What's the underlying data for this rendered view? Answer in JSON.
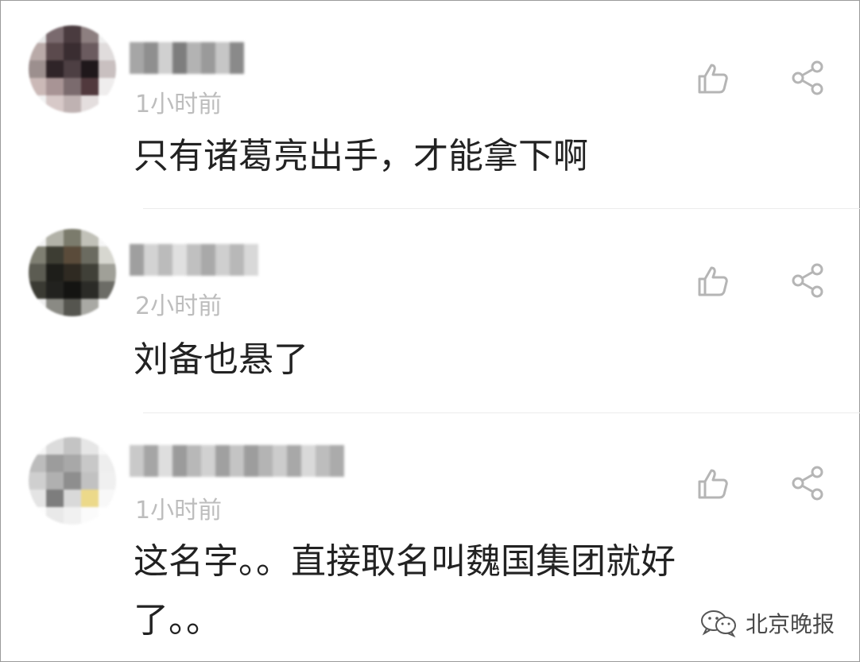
{
  "comments": [
    {
      "timestamp": "1小时前",
      "text": "只有诸葛亮出手，才能拿下啊",
      "avatar_colors": [
        "#e8e8e8",
        "#7a6a6e",
        "#4a3b3f",
        "#8d7f80",
        "#f0f0f0",
        "#b9aaa8",
        "#5b4a4d",
        "#3a2d31",
        "#6b5b5f",
        "#e0dcdc",
        "#9c8f8e",
        "#2f2428",
        "#4d3f43",
        "#1f181b",
        "#c9c0c0",
        "#cbb9b7",
        "#a89495",
        "#7b6b6e",
        "#51393d",
        "#efeded",
        "#f2f2f2",
        "#d7c9c8",
        "#bfb2b2",
        "#e4dede",
        "#ffffff"
      ],
      "username_colors": [
        "#a6a6a6",
        "#8f8f8f",
        "#d0d0d0",
        "#7d7d7d",
        "#b3b3b3",
        "#9a9a9a",
        "#c6c6c6",
        "#8a8a8a"
      ]
    },
    {
      "timestamp": "2小时前",
      "text": "刘备也悬了",
      "avatar_colors": [
        "#f3f3f3",
        "#b2b2a8",
        "#7b7b6c",
        "#c1c1b8",
        "#f6f6f6",
        "#7f7f72",
        "#3d3d33",
        "#5a4b3a",
        "#6b6b60",
        "#d7d7d0",
        "#5c5c52",
        "#1e1e1a",
        "#2f2a22",
        "#404038",
        "#a0a098",
        "#3a3a33",
        "#22221f",
        "#141412",
        "#2b2b27",
        "#6c6c66",
        "#eeeeee",
        "#8a8a84",
        "#55554f",
        "#a9a9a4",
        "#ffffff"
      ],
      "username_colors": [
        "#9f9f9f",
        "#d3d3d3",
        "#bbbbbb",
        "#e0e0e0",
        "#c0c0c0",
        "#a9a9a9",
        "#cfcfcf",
        "#b8b8b8",
        "#d8d8d8"
      ]
    },
    {
      "timestamp": "1小时前",
      "text_line1": "这名字。。直接取名叫魏国集团就好",
      "text_line2": "了。。",
      "avatar_colors": [
        "#f6f6f6",
        "#dcdcdc",
        "#c4c4c4",
        "#e6e6e6",
        "#fafafa",
        "#bcbcbc",
        "#9c9c9c",
        "#a8a8a8",
        "#c8c8c8",
        "#eeeeee",
        "#cfcfcf",
        "#b0b0b0",
        "#8e8e8e",
        "#c1c1c1",
        "#f0f0f0",
        "#e4e4e4",
        "#7d7d7d",
        "#d9d9d9",
        "#ecd98a",
        "#f8f8f8",
        "#fdfdfd",
        "#e9e9e9",
        "#f1f1f1",
        "#fbfbfb",
        "#ffffff"
      ],
      "username_colors": [
        "#c9c9c9",
        "#a5a5a5",
        "#dedede",
        "#9b9b9b",
        "#b8b8b8",
        "#d1d1d1",
        "#a0a0a0",
        "#c4c4c4",
        "#9d9d9d",
        "#b4b4b4",
        "#cccccc",
        "#a8a8a8",
        "#d9d9d9",
        "#bdbdbd",
        "#ababab"
      ]
    }
  ],
  "watermark": {
    "text": "北京晚报",
    "icon": "wechat-icon"
  },
  "icons": {
    "like": "thumbs-up-icon",
    "share": "share-icon"
  },
  "colors": {
    "text": "#222222",
    "timestamp": "#bdbdbd",
    "icon": "#b5b5b5",
    "divider": "#ececec"
  }
}
